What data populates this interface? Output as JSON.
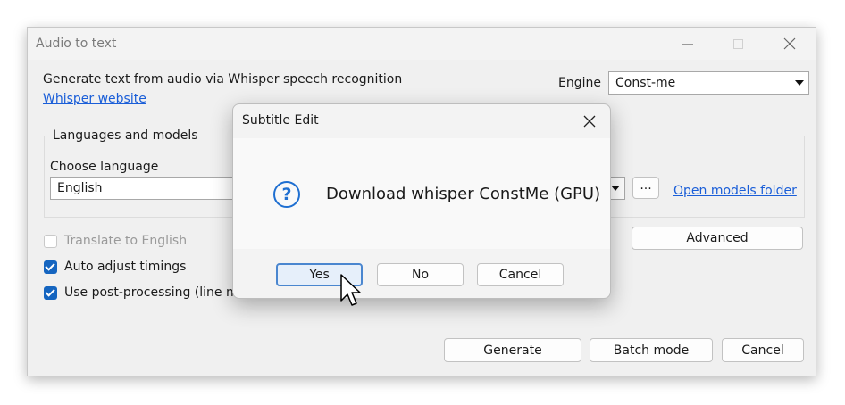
{
  "window": {
    "title": "Audio to text",
    "description": "Generate text from audio via Whisper speech recognition",
    "website_link": "Whisper website",
    "engine_label": "Engine",
    "engine_value": "Const-me",
    "group_label": "Languages and models",
    "language_label": "Choose language",
    "language_value": "English",
    "models_button_label": "...",
    "open_models_folder_link": "Open models folder",
    "advanced_button": "Advanced",
    "options": [
      {
        "label": "Translate to English",
        "checked": false,
        "enabled": false
      },
      {
        "label": "Auto adjust timings",
        "checked": true,
        "enabled": true
      },
      {
        "label": "Use post-processing (line me",
        "checked": true,
        "enabled": true
      }
    ],
    "generate_button": "Generate",
    "batch_button": "Batch mode",
    "cancel_button": "Cancel"
  },
  "dialog": {
    "title": "Subtitle Edit",
    "message": "Download whisper ConstMe (GPU)",
    "icon": "question-icon",
    "yes_button": "Yes",
    "no_button": "No",
    "cancel_button": "Cancel"
  },
  "colors": {
    "accent": "#1565c0",
    "link": "#1a5ed8",
    "question_icon": "#1f6fd1"
  }
}
